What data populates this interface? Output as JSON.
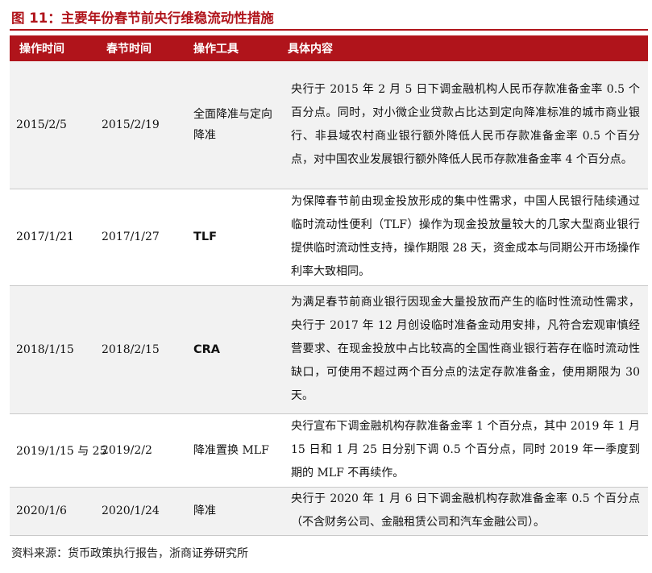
{
  "title": "图 11：主要年份春节前央行维稳流动性措施",
  "headers": [
    "操作时间",
    "春节时间",
    "操作工具",
    "具体内容"
  ],
  "rows": [
    {
      "op_date": "2015/2/5",
      "festival": "2015/2/19",
      "tool": "全面降准与定向降准",
      "content": "央行于 2015 年 2 月 5 日下调金融机构人民币存款准备金率 0.5 个百分点。同时，对小微企业贷款占比达到定向降准标准的城市商业银行、非县域农村商业银行额外降低人民币存款准备金率 0.5 个百分点，对中国农业发展银行额外降低人民币存款准备金率 4 个百分点。"
    },
    {
      "op_date": "2017/1/21",
      "festival": "2017/1/27",
      "tool": "TLF",
      "content": "为保障春节前由现金投放形成的集中性需求，中国人民银行陆续通过临时流动性便利（TLF）操作为现金投放量较大的几家大型商业银行提供临时流动性支持，操作期限 28 天，资金成本与同期公开市场操作利率大致相同。"
    },
    {
      "op_date": "2018/1/15",
      "festival": "2018/2/15",
      "tool": "CRA",
      "content": "为满足春节前商业银行因现金大量投放而产生的临时性流动性需求，央行于 2017 年 12 月创设临时准备金动用安排，凡符合宏观审慎经营要求、在现金投放中占比较高的全国性商业银行若存在临时流动性缺口，可使用不超过两个百分点的法定存款准备金，使用期限为 30 天。"
    },
    {
      "op_date": "2019/1/15 与 25",
      "festival": "2019/2/2",
      "tool": "降准置换 MLF",
      "content": "央行宣布下调金融机构存款准备金率 1 个百分点，其中 2019 年 1 月 15 日和 1 月 25 日分别下调 0.5 个百分点，同时 2019 年一季度到期的 MLF 不再续作。"
    },
    {
      "op_date": "2020/1/6",
      "festival": "2020/1/24",
      "tool": "降准",
      "content": "央行于 2020 年 1 月 6 日下调金融机构存款准备金率 0.5 个百分点（不含财务公司、金融租赁公司和汽车金融公司）。"
    }
  ],
  "source": "资料来源：货币政策执行报告，浙商证券研究所"
}
